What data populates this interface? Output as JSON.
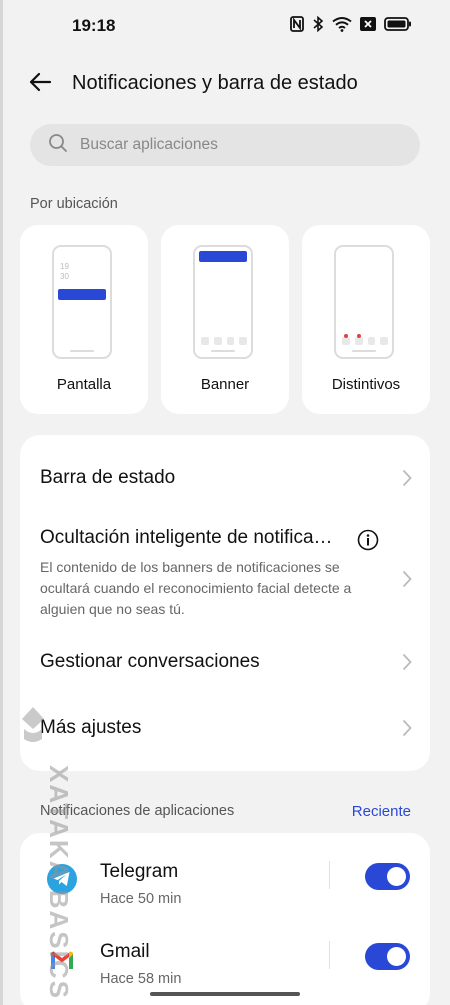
{
  "status_bar": {
    "time": "19:18",
    "icons": [
      "nfc-icon",
      "bluetooth-icon",
      "wifi-icon",
      "sim-off-icon",
      "battery-icon"
    ]
  },
  "header": {
    "back_icon": "arrow-left-icon",
    "title": "Notificaciones y barra de estado"
  },
  "search": {
    "icon": "search-icon",
    "placeholder": "Buscar aplicaciones"
  },
  "by_location": {
    "label": "Por ubicación",
    "options": [
      {
        "label": "Pantalla",
        "preview_clock_line1": "19",
        "preview_clock_line2": "30"
      },
      {
        "label": "Banner"
      },
      {
        "label": "Distintivos"
      }
    ]
  },
  "settings": [
    {
      "title": "Barra de estado"
    },
    {
      "title": "Ocultación inteligente de notifica…",
      "info_icon": "info-icon",
      "description": "El contenido de los banners de notificaciones se ocultará cuando el reconocimiento facial detecte a alguien que no seas tú."
    },
    {
      "title": "Gestionar conversaciones"
    },
    {
      "title": "Más ajustes"
    }
  ],
  "app_notifications": {
    "header": "Notificaciones de aplicaciones",
    "sort_label": "Reciente",
    "apps": [
      {
        "name": "Telegram",
        "time": "Hace 50 min",
        "icon": "telegram-icon",
        "enabled": true
      },
      {
        "name": "Gmail",
        "time": "Hace 58 min",
        "icon": "gmail-icon",
        "enabled": true
      }
    ]
  },
  "watermark": {
    "text": "XATAKA BASICS"
  },
  "colors": {
    "accent": "#2a48d6",
    "background": "#f2f2f2",
    "card": "#ffffff",
    "badge_red": "#e0433a"
  }
}
